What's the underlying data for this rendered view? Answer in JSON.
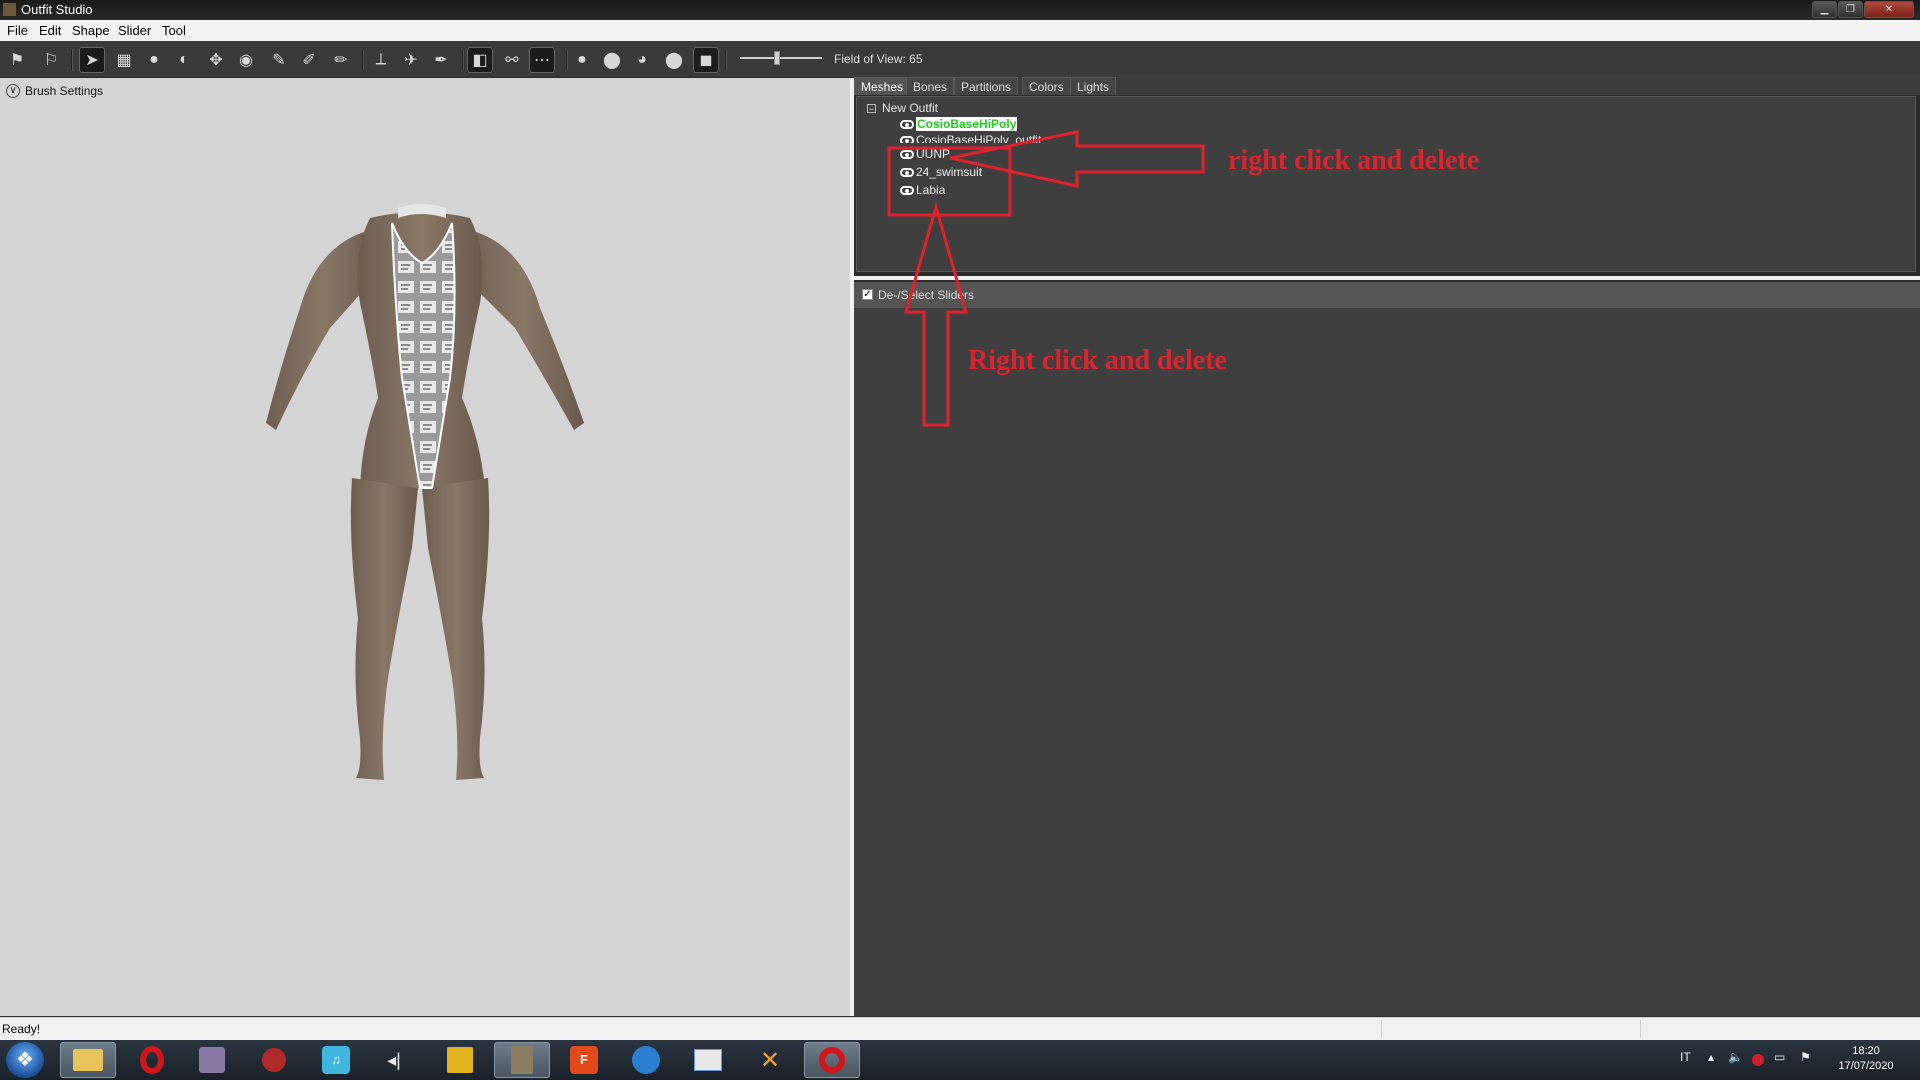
{
  "window": {
    "title": "Outfit Studio"
  },
  "menu": [
    "File",
    "Edit",
    "Shape",
    "Slider",
    "Tool"
  ],
  "toolbar": {
    "fov_label": "Field of View: 65",
    "fov_value": 65
  },
  "brush_settings": {
    "label": "Brush Settings"
  },
  "tabs": [
    "Meshes",
    "Bones",
    "Partitions",
    "Colors",
    "Lights"
  ],
  "active_tab": "Meshes",
  "mesh_tree": {
    "root": "New Outfit",
    "items": [
      "CosioBaseHiPoly",
      "CosioBaseHiPoly_outfit",
      "UUNP",
      "24_swimsuit",
      "Labia"
    ],
    "selected": "CosioBaseHiPoly"
  },
  "sliders": {
    "toggle_label": "De-/Select Sliders",
    "checked": true
  },
  "annotations": {
    "note_top": "right click and delete",
    "note_bottom": "Right click and delete",
    "color": "#e0222c"
  },
  "status": {
    "text": "Ready!"
  },
  "taskbar": {
    "language": "IT",
    "time": "18:20",
    "date": "17/07/2020"
  }
}
